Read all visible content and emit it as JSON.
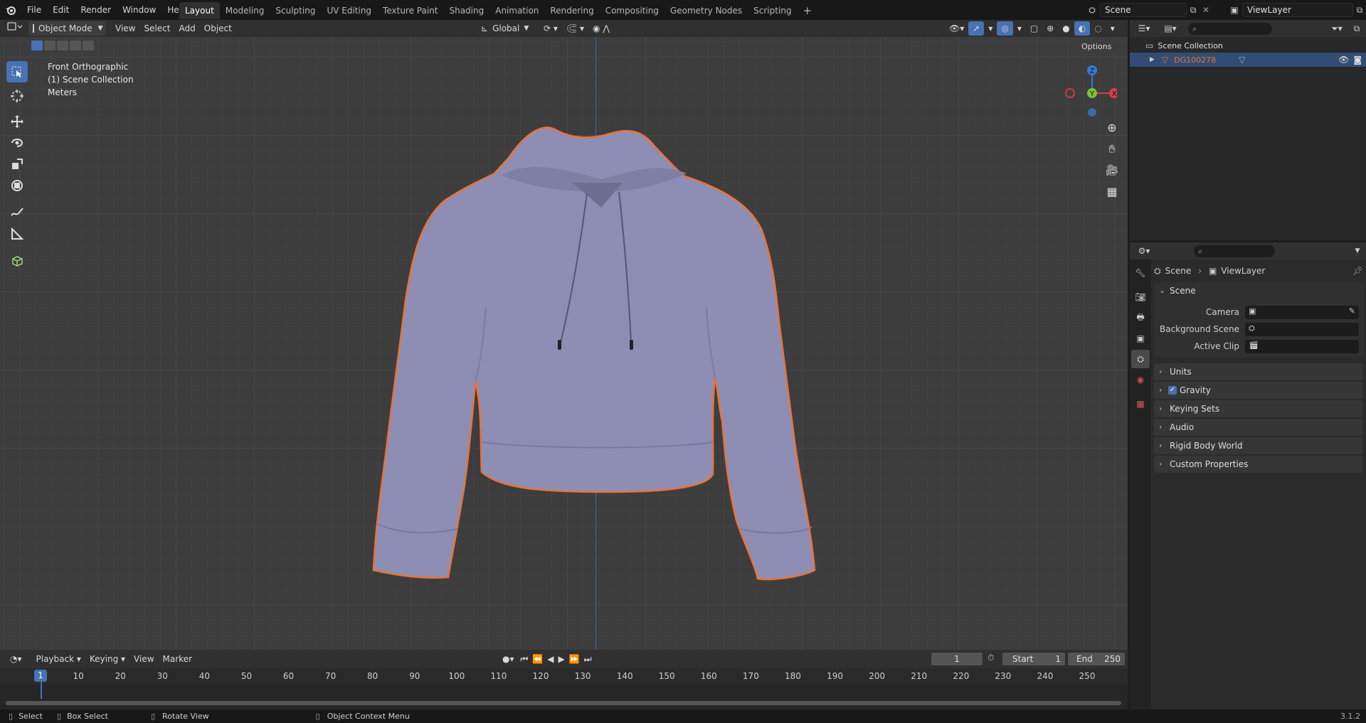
{
  "topbar": {
    "menus": [
      "File",
      "Edit",
      "Render",
      "Window",
      "Help"
    ],
    "workspaces": [
      "Layout",
      "Modeling",
      "Sculpting",
      "UV Editing",
      "Texture Paint",
      "Shading",
      "Animation",
      "Rendering",
      "Compositing",
      "Geometry Nodes",
      "Scripting"
    ],
    "active_workspace": "Layout",
    "add_workspace": "+",
    "scene_name": "Scene",
    "view_layer_name": "ViewLayer"
  },
  "viewport_header": {
    "mode": "Object Mode",
    "menus": [
      "View",
      "Select",
      "Add",
      "Object"
    ],
    "transform_orientation": "Global",
    "options_label": "Options"
  },
  "viewport": {
    "view_name": "Front Orthographic",
    "collection_info": "(1) Scene Collection",
    "units_info": "Meters",
    "object_color": "#8e8eb4",
    "selection_outline_color": "#e8733a",
    "gizmo": {
      "z": "Z",
      "y": "Y",
      "x": "X"
    }
  },
  "outliner": {
    "root": "Scene Collection",
    "items": [
      {
        "name": "DG100278",
        "color": "#e8733a"
      }
    ]
  },
  "properties": {
    "breadcrumb_scene": "Scene",
    "breadcrumb_viewlayer": "ViewLayer",
    "scene_panel": {
      "title": "Scene",
      "rows": [
        {
          "label": "Camera",
          "value": ""
        },
        {
          "label": "Background Scene",
          "value": ""
        },
        {
          "label": "Active Clip",
          "value": ""
        }
      ]
    },
    "panels": [
      "Units",
      "Gravity",
      "Keying Sets",
      "Audio",
      "Rigid Body World",
      "Custom Properties"
    ],
    "gravity_checked": true
  },
  "timeline": {
    "menus": [
      "Playback",
      "Keying",
      "View",
      "Marker"
    ],
    "current_frame": "1",
    "start_label": "Start",
    "start_value": "1",
    "end_label": "End",
    "end_value": "250",
    "ticks": [
      "1",
      "10",
      "20",
      "30",
      "40",
      "50",
      "60",
      "70",
      "80",
      "90",
      "100",
      "110",
      "120",
      "130",
      "140",
      "150",
      "160",
      "170",
      "180",
      "190",
      "200",
      "210",
      "220",
      "230",
      "240",
      "250"
    ]
  },
  "statusbar": {
    "select": "Select",
    "box_select": "Box Select",
    "rotate_view": "Rotate View",
    "context_menu": "Object Context Menu",
    "version": "3.1.2"
  },
  "colors": {
    "accent": "#4772b3",
    "active_object": "#e8733a"
  }
}
